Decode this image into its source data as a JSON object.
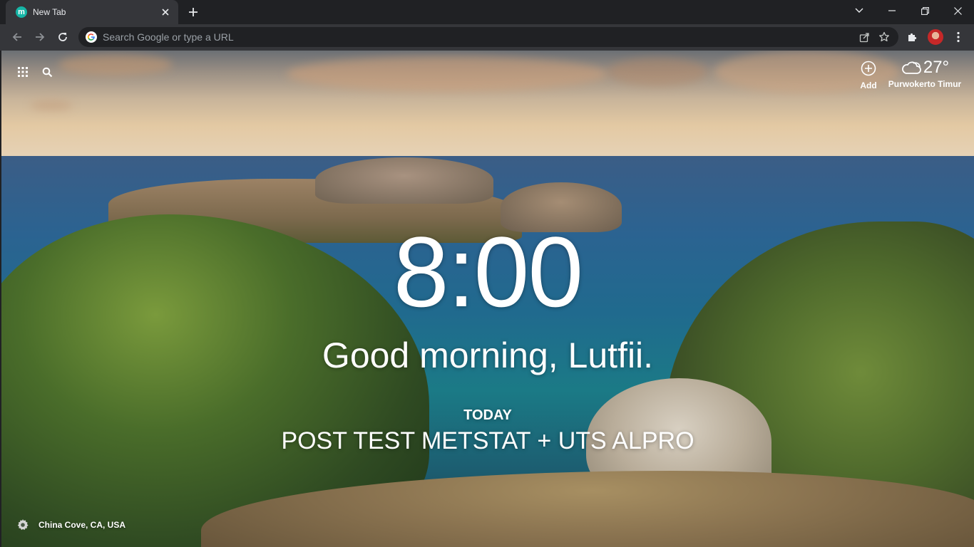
{
  "browser": {
    "tab": {
      "favicon_letter": "m",
      "title": "New Tab"
    },
    "omnibox": {
      "placeholder": "Search Google or type a URL"
    }
  },
  "newtab": {
    "add": {
      "label": "Add"
    },
    "weather": {
      "temperature": "27°",
      "location": "Purwokerto Timur",
      "icon": "cloud-icon"
    },
    "clock": "8:00",
    "greeting": "Good morning, Lutfii.",
    "today": {
      "label": "TODAY",
      "focus": "POST TEST METSTAT + UTS ALPRO"
    },
    "photo_location": "China Cove, CA, USA"
  },
  "colors": {
    "tab_strip": "#202124",
    "toolbar": "#35363a",
    "omnibox": "#202124",
    "favicon": "#16b5a6",
    "text": "#ffffff"
  }
}
